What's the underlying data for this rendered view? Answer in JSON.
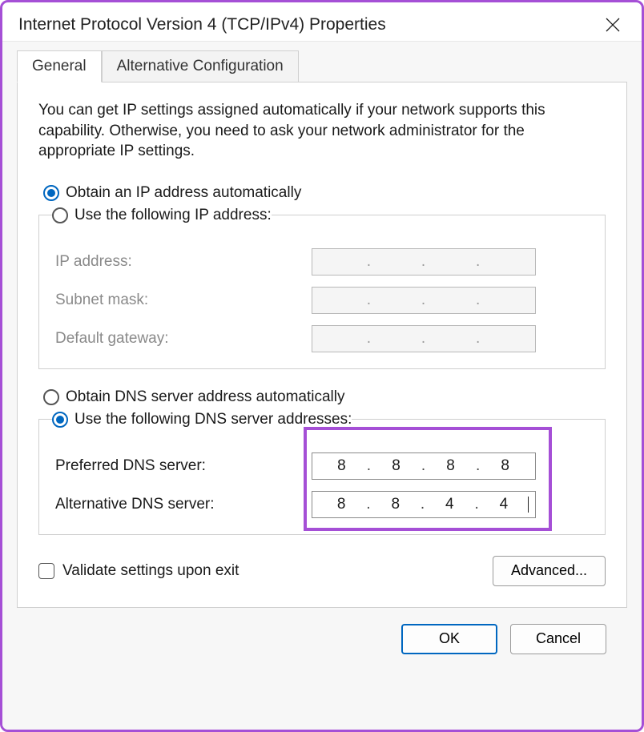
{
  "window": {
    "title": "Internet Protocol Version 4 (TCP/IPv4) Properties"
  },
  "tabs": {
    "general": "General",
    "alt": "Alternative Configuration"
  },
  "intro": "You can get IP settings assigned automatically if your network supports this capability. Otherwise, you need to ask your network administrator for the appropriate IP settings.",
  "ip_section": {
    "auto_label": "Obtain an IP address automatically",
    "manual_label": "Use the following IP address:",
    "auto_selected": true,
    "fields": {
      "ip_addr_label": "IP address:",
      "subnet_label": "Subnet mask:",
      "gateway_label": "Default gateway:",
      "ip_addr": [
        "",
        "",
        "",
        ""
      ],
      "subnet": [
        "",
        "",
        "",
        ""
      ],
      "gateway": [
        "",
        "",
        "",
        ""
      ]
    }
  },
  "dns_section": {
    "auto_label": "Obtain DNS server address automatically",
    "manual_label": "Use the following DNS server addresses:",
    "manual_selected": true,
    "fields": {
      "preferred_label": "Preferred DNS server:",
      "alternate_label": "Alternative DNS server:",
      "preferred": [
        "8",
        "8",
        "8",
        "8"
      ],
      "alternate": [
        "8",
        "8",
        "4",
        "4"
      ]
    }
  },
  "validate_label": "Validate settings upon exit",
  "validate_checked": false,
  "buttons": {
    "advanced": "Advanced...",
    "ok": "OK",
    "cancel": "Cancel"
  },
  "highlight": {
    "purpose": "dns-server-inputs-annotation"
  }
}
